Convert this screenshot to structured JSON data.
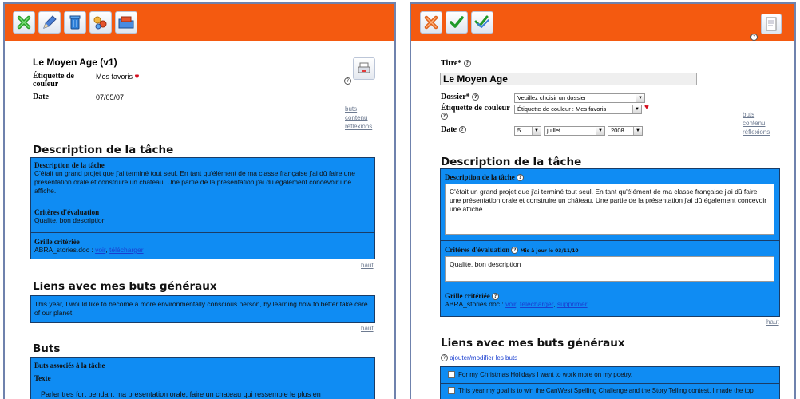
{
  "left": {
    "toolbar": {
      "icons": [
        "close-x-icon",
        "edit-pencil-icon",
        "trash-icon",
        "share-icon",
        "move-folder-icon"
      ]
    },
    "title": "Le Moyen Age (v1)",
    "meta": {
      "label_tag": "Étiquette de couleur",
      "tag_value": "Mes favoris",
      "label_date": "Date",
      "date_value": "07/05/07"
    },
    "side_links": [
      "buts",
      "contenu",
      "réflexions"
    ],
    "description_heading": "Description de la tâche",
    "desc_box": {
      "title": "Description de la tâche",
      "text": "C'était un grand projet que j'ai terminé tout seul. En tant qu'élément de ma classe française j'ai dû faire une présentation orale et construire un château. Une partie de la présentation j'ai dû également concevoir une affiche.",
      "criteria_title": "Critères d'évaluation",
      "criteria_text": "Qualite, bon description",
      "grid_title": "Grille critériée",
      "grid_file": "ABRA_stories.doc : ",
      "grid_view": "voir",
      "grid_sep": ", ",
      "grid_download": "télécharger"
    },
    "haut1": "haut",
    "goals_heading": "Liens avec mes buts généraux",
    "goals_text": "This year, I would like to become a more environmentally conscious person, by learning how to better take care of our planet.",
    "haut2": "haut",
    "buts_heading": "Buts",
    "buts_box": {
      "title": "Buts associés à la tâche",
      "texte_label": "Texte",
      "text": "Parler tres fort pendant ma presentation orale, faire un chateau qui ressemple le plus en"
    }
  },
  "right": {
    "toolbar": {
      "icons": [
        "cancel-x-icon",
        "save-check-icon",
        "save-all-check-icon",
        "document-icon"
      ]
    },
    "labels": {
      "titre": "Titre*",
      "dossier": "Dossier*",
      "etiquette": "Étiquette de couleur",
      "date": "Date"
    },
    "title_value": "Le Moyen Age",
    "dossier_value": "Veuillez choisir un dossier",
    "etiquette_value": "Étiquette de couleur : Mes favoris",
    "date_day": "5",
    "date_month": "juillet",
    "date_year": "2008",
    "side_links": [
      "buts",
      "contenu",
      "réflexions"
    ],
    "description_heading": "Description de la tâche",
    "desc_box": {
      "title": "Description de la tâche",
      "text": "C'était un grand projet que j'ai terminé tout seul. En tant qu'élément de ma classe française j'ai dû faire une présentation orale et construire un château. Une partie de la présentation j'ai dû également concevoir une affiche.",
      "criteria_title": "Critères d'évaluation",
      "criteria_updated": "Mis à jour le 03/11/10",
      "criteria_text": "Qualite, bon description",
      "grid_title": "Grille critériée",
      "grid_file": "ABRA_stories.doc : ",
      "grid_view": "voir",
      "grid_download": "télécharger",
      "grid_delete": "supprimer"
    },
    "haut": "haut",
    "goals_heading": "Liens avec mes buts généraux",
    "goals_link": "ajouter/modifier les buts",
    "goals": [
      "For my Christmas Holidays I want to work more on my poetry.",
      "This year my goal is to win the CanWest Spelling Challenge and the Story Telling contest. I made the top"
    ]
  }
}
